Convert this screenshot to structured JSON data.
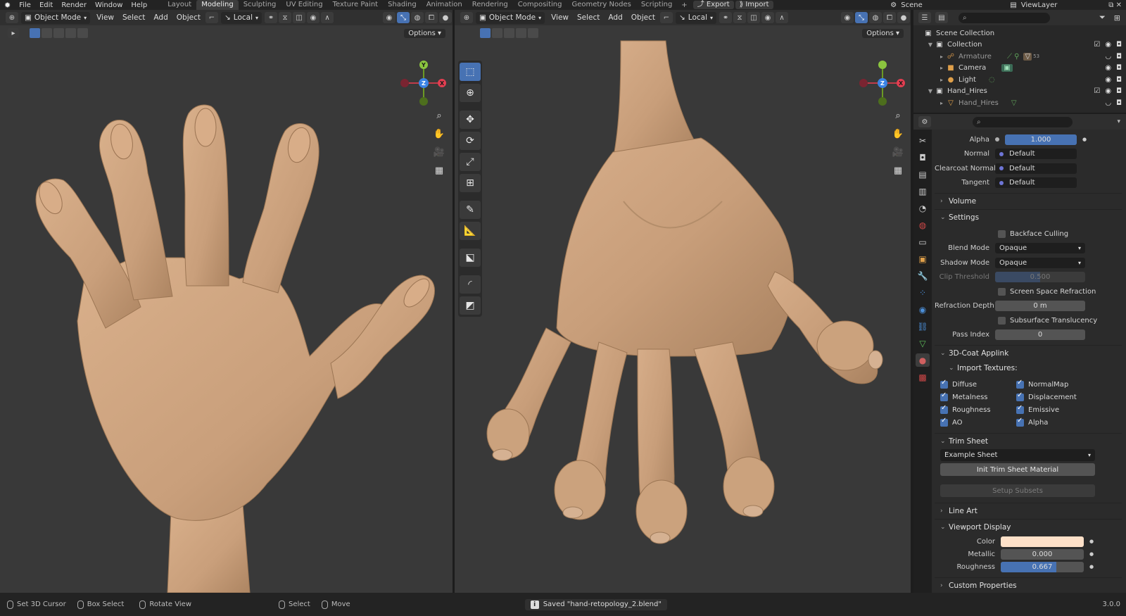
{
  "menu": {
    "items": [
      "File",
      "Edit",
      "Render",
      "Window",
      "Help"
    ]
  },
  "workspaces": [
    "Layout",
    "Modeling",
    "Sculpting",
    "UV Editing",
    "Texture Paint",
    "Shading",
    "Animation",
    "Rendering",
    "Compositing",
    "Geometry Nodes",
    "Scripting"
  ],
  "workspace_active": "Modeling",
  "top_right": {
    "export_label": "Export",
    "import_label": "Import",
    "scene": "Scene",
    "view_layer": "ViewLayer"
  },
  "viewport_left": {
    "mode": "Object Mode",
    "menus": [
      "View",
      "Select",
      "Add",
      "Object"
    ],
    "transform_orientation": "Local",
    "options_label": "Options"
  },
  "viewport_right": {
    "mode": "Object Mode",
    "menus": [
      "View",
      "Select",
      "Add",
      "Object"
    ],
    "transform_orientation": "Local",
    "options_label": "Options"
  },
  "gizmo": {
    "x": "X",
    "y": "Y",
    "z": "Z"
  },
  "outliner": {
    "root": "Scene Collection",
    "rows": [
      {
        "label": "Collection",
        "level": 1,
        "icon": "collection-icon",
        "dim": false
      },
      {
        "label": "Armature",
        "level": 2,
        "icon": "armature-icon",
        "dim": true,
        "extra": "53"
      },
      {
        "label": "Camera",
        "level": 2,
        "icon": "camera-icon",
        "dim": false
      },
      {
        "label": "Light",
        "level": 2,
        "icon": "light-icon",
        "dim": false
      },
      {
        "label": "Hand_Hires",
        "level": 1,
        "icon": "collection-icon",
        "dim": false
      },
      {
        "label": "Hand_Hires",
        "level": 2,
        "icon": "mesh-icon",
        "dim": true
      }
    ]
  },
  "props": {
    "top_rows": [
      {
        "label": "Alpha",
        "value": "1.000",
        "type": "slider",
        "fill": 1.0
      },
      {
        "label": "Normal",
        "value": "Default",
        "type": "socket"
      },
      {
        "label": "Clearcoat Normal",
        "value": "Default",
        "type": "socket"
      },
      {
        "label": "Tangent",
        "value": "Default",
        "type": "socket"
      }
    ],
    "volume_label": "Volume",
    "settings_label": "Settings",
    "settings": {
      "backface_culling": "Backface Culling",
      "blend_mode_label": "Blend Mode",
      "blend_mode_value": "Opaque",
      "shadow_mode_label": "Shadow Mode",
      "shadow_mode_value": "Opaque",
      "clip_threshold_label": "Clip Threshold",
      "clip_threshold_value": "0.500",
      "clip_threshold_fill": 0.5,
      "ssr_label": "Screen Space Refraction",
      "refraction_depth_label": "Refraction Depth",
      "refraction_depth_value": "0 m",
      "subsurface_label": "Subsurface Translucency",
      "pass_index_label": "Pass Index",
      "pass_index_value": "0"
    },
    "applink_label": "3D-Coat Applink",
    "import_textures_label": "Import Textures:",
    "textures": [
      {
        "label": "Diffuse",
        "checked": true
      },
      {
        "label": "NormalMap",
        "checked": true
      },
      {
        "label": "Metalness",
        "checked": true
      },
      {
        "label": "Displacement",
        "checked": true
      },
      {
        "label": "Roughness",
        "checked": true
      },
      {
        "label": "Emissive",
        "checked": true
      },
      {
        "label": "AO",
        "checked": true
      },
      {
        "label": "Alpha",
        "checked": true
      }
    ],
    "trim_sheet_label": "Trim Sheet",
    "trim_sheet_value": "Example Sheet",
    "init_trim_label": "Init Trim Sheet Material",
    "setup_subsets_label": "Setup Subsets",
    "line_art_label": "Line Art",
    "viewport_display_label": "Viewport Display",
    "vd": {
      "color_label": "Color",
      "color_value": "#fde0c8",
      "metallic_label": "Metallic",
      "metallic_value": "0.000",
      "metallic_fill": 0.0,
      "roughness_label": "Roughness",
      "roughness_value": "0.667",
      "roughness_fill": 0.667
    },
    "custom_props_label": "Custom Properties"
  },
  "status": {
    "set_cursor": "Set 3D Cursor",
    "box_select": "Box Select",
    "rotate_view": "Rotate View",
    "select": "Select",
    "move": "Move",
    "saved_message": "Saved \"hand-retopology_2.blend\"",
    "version": "3.0.0"
  },
  "colors": {
    "accent": "#4772b3",
    "skin": "#c9a07c",
    "viewport_bg": "#393939"
  }
}
